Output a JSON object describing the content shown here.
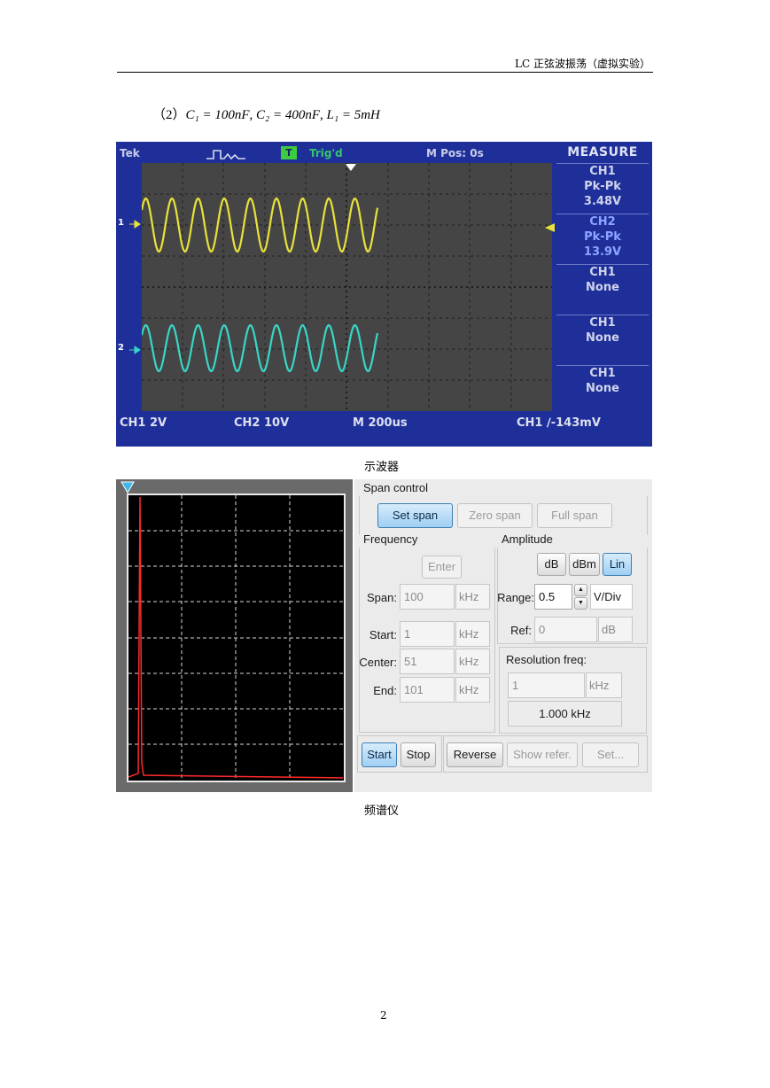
{
  "header": {
    "title": "LC 正弦波振荡（虚拟实验）"
  },
  "formula": {
    "index": "（2）",
    "c1": "C₁ = 100nF",
    "c2": "C₂ = 400nF",
    "l1": "L₁ = 5mH"
  },
  "oscilloscope": {
    "brand": "Tek",
    "trig_icon": "T",
    "trig_status": "Trig'd",
    "m_pos": "M Pos: 0s",
    "measure_title": "MEASURE",
    "ch1_marker": "1",
    "ch2_marker": "2",
    "measurements": [
      {
        "channel": "CH1",
        "type": "Pk-Pk",
        "value": "3.48V"
      },
      {
        "channel": "CH2",
        "type": "Pk-Pk",
        "value": "13.9V"
      },
      {
        "channel": "CH1",
        "type": "None",
        "value": ""
      },
      {
        "channel": "CH1",
        "type": "None",
        "value": ""
      },
      {
        "channel": "CH1",
        "type": "None",
        "value": ""
      }
    ],
    "ch1_scale": "CH1 2V",
    "ch2_scale": "CH2 10V",
    "timebase": "M 200us",
    "trigger_level": "CH1 ∕-143mV",
    "colors": {
      "ch1": "#e8e23a",
      "ch2": "#39d6c6",
      "background": "#1f2f9a",
      "screen": "#454545"
    }
  },
  "oscilloscope_caption": "示波器",
  "spectrum_caption": "频谱仪",
  "spectrum": {
    "colors": {
      "trace": "#ff2a2a",
      "screen": "#000000",
      "marker": "#3fb6e8"
    },
    "peak_fraction": 0.05
  },
  "panel": {
    "span_control": {
      "title": "Span control",
      "set_span": "Set span",
      "zero_span": "Zero span",
      "full_span": "Full span"
    },
    "frequency": {
      "title": "Frequency",
      "enter": "Enter",
      "span_label": "Span:",
      "span_value": "100",
      "span_unit": "kHz",
      "start_label": "Start:",
      "start_value": "1",
      "start_unit": "kHz",
      "center_label": "Center:",
      "center_value": "51",
      "center_unit": "kHz",
      "end_label": "End:",
      "end_value": "101",
      "end_unit": "kHz"
    },
    "amplitude": {
      "title": "Amplitude",
      "db": "dB",
      "dbm": "dBm",
      "lin": "Lin",
      "range_label": "Range:",
      "range_value": "0.5",
      "range_unit": "V/Div",
      "ref_label": "Ref:",
      "ref_value": "0",
      "ref_unit": "dB"
    },
    "resolution": {
      "title": "Resolution freq:",
      "value": "1",
      "unit": "kHz",
      "readout": "1.000 kHz"
    },
    "buttons": {
      "start": "Start",
      "stop": "Stop",
      "reverse": "Reverse",
      "show_refer": "Show refer.",
      "set": "Set..."
    }
  },
  "footer": {
    "page_number": "2"
  }
}
